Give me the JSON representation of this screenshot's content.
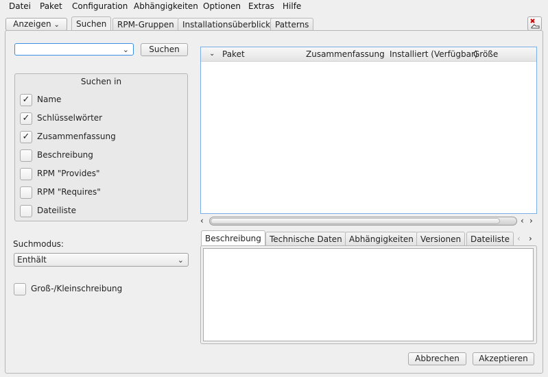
{
  "menu": [
    "Datei",
    "Paket",
    "Configuration",
    "Abhängigkeiten",
    "Optionen",
    "Extras",
    "Hilfe"
  ],
  "top_tabs": {
    "anzeigen": "Anzeigen",
    "suchen": "Suchen",
    "rpm_gruppen": "RPM-Gruppen",
    "installation": "Installationsüberblick",
    "patterns": "Patterns"
  },
  "search": {
    "input_value": "",
    "button": "Suchen"
  },
  "search_in": {
    "title": "Suchen in",
    "items": [
      {
        "label": "Name",
        "checked": "✓"
      },
      {
        "label": "Schlüsselwörter",
        "checked": "✓"
      },
      {
        "label": "Zusammenfassung",
        "checked": "✓"
      },
      {
        "label": "Beschreibung",
        "checked": ""
      },
      {
        "label": "RPM \"Provides\"",
        "checked": ""
      },
      {
        "label": "RPM \"Requires\"",
        "checked": ""
      },
      {
        "label": "Dateiliste",
        "checked": ""
      }
    ]
  },
  "suchmodus": {
    "label": "Suchmodus:",
    "value": "Enthält"
  },
  "case": {
    "label": "Groß-/Kleinschreibung",
    "checked": ""
  },
  "table": {
    "columns": [
      "Paket",
      "Zusammenfassung",
      "Installiert (Verfügbar)",
      "Größe"
    ]
  },
  "detail_tabs": [
    "Beschreibung",
    "Technische Daten",
    "Abhängigkeiten",
    "Versionen",
    "Dateiliste"
  ],
  "buttons": {
    "cancel": "Abbrechen",
    "accept": "Akzeptieren"
  }
}
